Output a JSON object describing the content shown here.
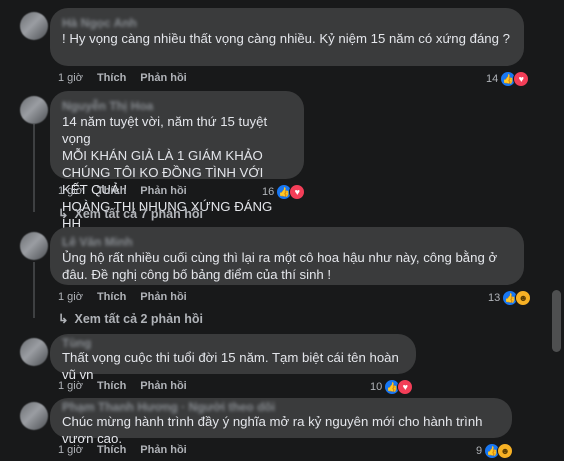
{
  "comments": [
    {
      "author": "Hà Ngọc Anh",
      "text": "! Hy vọng càng nhiều thất vọng càng nhiều. Kỷ niệm 15 năm có xứng đáng ?",
      "time": "1 giờ",
      "like_label": "Thích",
      "reply_label": "Phản hồi",
      "reaction_count": "14",
      "reactions": [
        "like-icon",
        "love-icon"
      ]
    },
    {
      "author": "Nguyễn Thị Hoa",
      "text": "14 năm tuyệt vời, năm thứ 15 tuyệt vọng\nMỖI KHÁN GIẢ LÀ 1 GIÁM KHẢO\nCHÚNG TÔI KO ĐỒNG TÌNH VỚI KẾT QUẢ !\nHOÀNG THỊ NHUNG XỨNG ĐÁNG HH",
      "time": "1 giờ",
      "like_label": "Thích",
      "reply_label": "Phản hồi",
      "reaction_count": "16",
      "reactions": [
        "like-icon",
        "love-icon"
      ],
      "view_replies": "Xem tất cả 7 phản hồi"
    },
    {
      "author": "Lê Văn Minh",
      "text": "Ủng hộ rất nhiều cuối cùng thì lại ra một cô hoa hậu như này, công bằng ở đâu. Đề nghị công bố bảng điểm của thí sinh !",
      "time": "1 giờ",
      "like_label": "Thích",
      "reply_label": "Phản hồi",
      "reaction_count": "13",
      "reactions": [
        "like-icon",
        "haha-icon"
      ],
      "view_replies": "Xem tất cả 2 phản hồi"
    },
    {
      "author": "Tùng",
      "text": "Thất vọng cuộc thi tuổi đời 15 năm. Tạm biệt cái tên hoàn vũ vn",
      "time": "1 giờ",
      "like_label": "Thích",
      "reply_label": "Phản hồi",
      "reaction_count": "10",
      "reactions": [
        "like-icon",
        "love-icon"
      ]
    },
    {
      "author": "Phạm Thanh Hương · Người theo dõi",
      "text": "Chúc mừng hành trình đầy ý nghĩa mở ra kỷ nguyên mới cho hành trình vươn cao.",
      "time": "1 giờ",
      "like_label": "Thích",
      "reply_label": "Phản hồi",
      "reaction_count": "9",
      "reactions": [
        "like-icon",
        "haha-icon"
      ]
    }
  ]
}
